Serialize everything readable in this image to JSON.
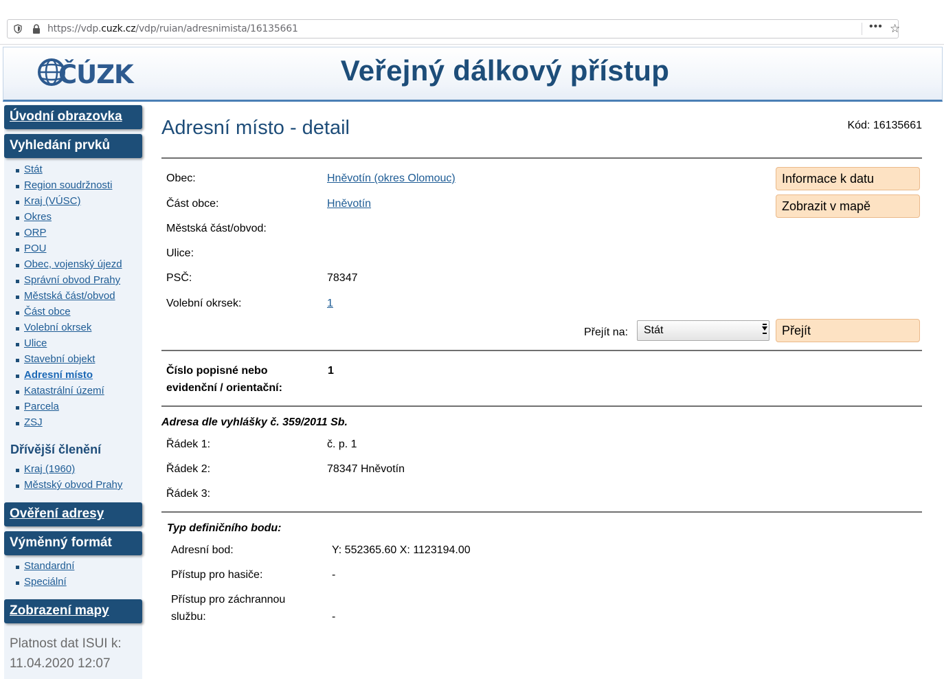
{
  "browser": {
    "url_prefix": "https://vdp.",
    "url_domain": "cuzk.cz",
    "url_path": "/vdp/ruian/adresnimista/16135661",
    "menu_dots": "•••",
    "star": "☆"
  },
  "header": {
    "logo_text": "ČÚZK",
    "title": "Veřejný dálkový přístup"
  },
  "sidebar": {
    "home": "Úvodní obrazovka",
    "search_head": "Vyhledání prvků",
    "search_items": [
      "Stát",
      "Region soudržnosti",
      "Kraj (VÚSC)",
      "Okres",
      "ORP",
      "POU",
      "Obec, vojenský újezd",
      "Správní obvod Prahy",
      "Městská část/obvod",
      "Část obce",
      "Volební okrsek",
      "Ulice",
      "Stavební objekt",
      "Adresní místo",
      "Katastrální území",
      "Parcela",
      "ZSJ"
    ],
    "active_item": "Adresní místo",
    "former_head": "Dřívější členění",
    "former_items": [
      "Kraj (1960)",
      "Městský obvod Prahy"
    ],
    "verify": "Ověření adresy",
    "exchange_head": "Výměnný formát",
    "exchange_items": [
      "Standardní",
      "Speciální"
    ],
    "map": "Zobrazení mapy",
    "validity_label": "Platnost dat ISUI k:",
    "validity_date": "11.04.2020 12:07"
  },
  "main": {
    "title": "Adresní místo - detail",
    "code": "Kód: 16135661",
    "fields": {
      "obec_label": "Obec:",
      "obec_value": "Hněvotín (okres Olomouc)",
      "cast_obce_label": "Část obce:",
      "cast_obce_value": "Hněvotín",
      "mestska_cast_label": "Městská část/obvod:",
      "ulice_label": "Ulice:",
      "psc_label": "PSČ:",
      "psc_value": "78347",
      "volebni_label": "Volební okrsek:",
      "volebni_value": "1"
    },
    "buttons": {
      "info": "Informace k datu",
      "map": "Zobrazit v mapě",
      "go": "Přejít"
    },
    "goto_label": "Přejít na:",
    "goto_selected": "Stát",
    "cislo_label_1": "Číslo popisné nebo",
    "cislo_label_2": "evidenční / orientační:",
    "cislo_value": "1",
    "address_head": "Adresa dle vyhlášky č. 359/2011 Sb.",
    "rows": [
      {
        "label": "Řádek 1:",
        "value": "č. p. 1"
      },
      {
        "label": "Řádek 2:",
        "value": "78347 Hněvotín"
      },
      {
        "label": "Řádek 3:",
        "value": ""
      }
    ],
    "def_head": "Typ definičního bodu:",
    "def_rows": {
      "bod_label": "Adresní bod:",
      "bod_value": "Y: 552365.60 X: 1123194.00",
      "hasici_label": "Přístup pro hasiče:",
      "hasici_value": "-",
      "zachranna_label_1": "Přístup pro záchrannou",
      "zachranna_label_2": "službu:",
      "zachranna_value": "-"
    }
  },
  "colors": {
    "nav_bg": "#1d4e78",
    "link": "#1e5c95",
    "button_bg": "#fde2c3",
    "title": "#1e4d79"
  }
}
